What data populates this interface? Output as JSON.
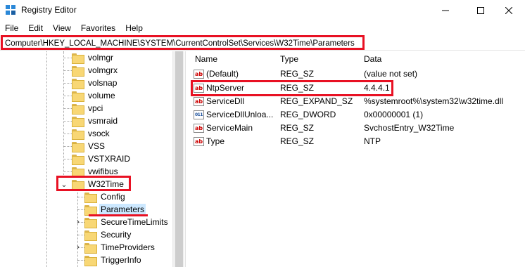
{
  "window": {
    "title": "Registry Editor",
    "icon": "registry-editor-icon"
  },
  "window_controls": {
    "minimize": "─",
    "maximize": "☐",
    "close": "✕"
  },
  "menu": [
    "File",
    "Edit",
    "View",
    "Favorites",
    "Help"
  ],
  "address": {
    "path": "Computer\\HKEY_LOCAL_MACHINE\\SYSTEM\\CurrentControlSet\\Services\\W32Time\\Parameters"
  },
  "tree": {
    "items": [
      {
        "label": "volmgr"
      },
      {
        "label": "volmgrx"
      },
      {
        "label": "volsnap"
      },
      {
        "label": "volume"
      },
      {
        "label": "vpci"
      },
      {
        "label": "vsmraid"
      },
      {
        "label": "vsock"
      },
      {
        "label": "VSS"
      },
      {
        "label": "VSTXRAID"
      },
      {
        "label": "vwifibus"
      },
      {
        "label": "W32Time",
        "expanded": true
      },
      {
        "label": "Config"
      },
      {
        "label": "Parameters",
        "selected": true
      },
      {
        "label": "SecureTimeLimits"
      },
      {
        "label": "Security"
      },
      {
        "label": "TimeProviders"
      },
      {
        "label": "TriggerInfo"
      }
    ],
    "chevron_expanded": "⌄",
    "chevron_collapsed": "›"
  },
  "list": {
    "columns": [
      "Name",
      "Type",
      "Data"
    ],
    "rows": [
      {
        "icon": "ab",
        "name": "(Default)",
        "type": "REG_SZ",
        "data": "(value not set)"
      },
      {
        "icon": "ab",
        "name": "NtpServer",
        "type": "REG_SZ",
        "data": "4.4.4.1"
      },
      {
        "icon": "ab",
        "name": "ServiceDll",
        "type": "REG_EXPAND_SZ",
        "data": "%systemroot%\\system32\\w32time.dll"
      },
      {
        "icon": "011",
        "name": "ServiceDllUnloa...",
        "type": "REG_DWORD",
        "data": "0x00000001 (1)"
      },
      {
        "icon": "ab",
        "name": "ServiceMain",
        "type": "REG_SZ",
        "data": "SvchostEntry_W32Time"
      },
      {
        "icon": "ab",
        "name": "Type",
        "type": "REG_SZ",
        "data": "NTP"
      }
    ]
  },
  "colors": {
    "highlight": "#e81123",
    "selection": "#cce8ff",
    "folder": "#f8d775"
  }
}
